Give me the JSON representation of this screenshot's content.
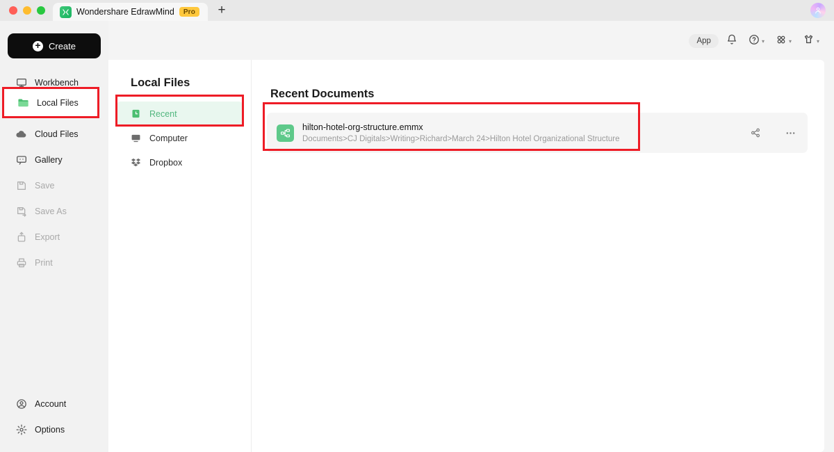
{
  "window": {
    "tab_title": "Wondershare EdrawMind",
    "badge": "Pro",
    "new_tab_glyph": "+",
    "traffic_lights": [
      "close",
      "minimize",
      "zoom"
    ]
  },
  "toolbar": {
    "app_label": "App",
    "items": [
      {
        "name": "notifications-icon",
        "caret": false
      },
      {
        "name": "help-icon",
        "caret": true,
        "caret_glyph": "▾"
      },
      {
        "name": "apps-grid-icon",
        "caret": true,
        "caret_glyph": "▾"
      },
      {
        "name": "theme-icon",
        "caret": true,
        "caret_glyph": "▾"
      }
    ],
    "caret_glyph": "▾"
  },
  "sidebar": {
    "create_label": "Create",
    "create_plus": "+",
    "items": [
      {
        "label": "Workbench",
        "icon": "workbench-icon",
        "state": "enabled",
        "active": false
      },
      {
        "label": "Local Files",
        "icon": "folder-icon",
        "state": "enabled",
        "active": true
      },
      {
        "label": "Cloud Files",
        "icon": "cloud-icon",
        "state": "enabled",
        "active": false
      },
      {
        "label": "Gallery",
        "icon": "gallery-icon",
        "state": "enabled",
        "active": false
      },
      {
        "label": "Save",
        "icon": "save-icon",
        "state": "disabled",
        "active": false
      },
      {
        "label": "Save As",
        "icon": "save-as-icon",
        "state": "disabled",
        "active": false
      },
      {
        "label": "Export",
        "icon": "export-icon",
        "state": "disabled",
        "active": false
      },
      {
        "label": "Print",
        "icon": "print-icon",
        "state": "disabled",
        "active": false
      }
    ],
    "bottom_items": [
      {
        "label": "Account",
        "icon": "account-icon"
      },
      {
        "label": "Options",
        "icon": "gear-icon"
      }
    ]
  },
  "local_files_panel": {
    "title": "Local Files",
    "items": [
      {
        "label": "Recent",
        "icon": "recent-clock-icon",
        "active": true
      },
      {
        "label": "Computer",
        "icon": "monitor-icon",
        "active": false
      },
      {
        "label": "Dropbox",
        "icon": "dropbox-icon",
        "active": false
      }
    ]
  },
  "main": {
    "title": "Recent Documents",
    "documents": [
      {
        "name": "hilton-hotel-org-structure.emmx",
        "path": "Documents>CJ Digitals>Writing>Richard>March 24>Hilton Hotel Organizational Structure",
        "icon": "mindmap-file-icon",
        "actions": [
          {
            "name": "share-icon",
            "glyph": "share"
          },
          {
            "name": "more-options-icon",
            "glyph": "•••"
          }
        ]
      }
    ]
  },
  "annotations": [
    {
      "name": "highlight-local-files",
      "color": "#ee1c26"
    },
    {
      "name": "highlight-recent",
      "color": "#ee1c26"
    },
    {
      "name": "highlight-recent-document",
      "color": "#ee1c26"
    }
  ],
  "colors": {
    "accent_green": "#52b77f",
    "annotation_red": "#ee1c26",
    "pro_badge": "#ffc83d"
  }
}
